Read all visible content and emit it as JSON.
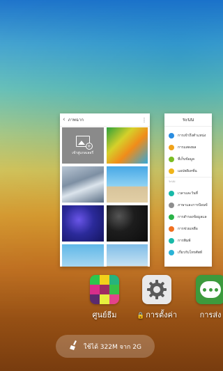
{
  "recent_apps": {
    "gallery_card": {
      "title": "ภาพฉาก",
      "open_gallery_label": "เข้าสู่แกลเลอรี่"
    },
    "settings_card": {
      "title": "ระบบ",
      "items": [
        {
          "label": "การเข้าถึงตำแหน่ง",
          "color": "#2a8de0"
        },
        {
          "label": "การแสดงผล",
          "color": "#f0a21a"
        },
        {
          "label": "ที่เก็บข้อมูล",
          "color": "#7bbd24"
        },
        {
          "label": "แอปพลิเคชั่น",
          "color": "#f0b51a"
        }
      ],
      "section_label": "ระบบ",
      "items2": [
        {
          "label": "เวลาและวันที่",
          "color": "#19b9a8"
        },
        {
          "label": "ภาษาและการป้อนข้",
          "color": "#8e8e8e"
        },
        {
          "label": "การสำรองข้อมูลแล",
          "color": "#2bb348"
        },
        {
          "label": "การช่วยเหลือ",
          "color": "#f07020"
        },
        {
          "label": "การพิมพ์",
          "color": "#19b9a8"
        },
        {
          "label": "เกี่ยวกับโทรศัพท์",
          "color": "#2bb3d6"
        }
      ]
    }
  },
  "dock_apps": [
    {
      "label": "ศูนย์ธีม"
    },
    {
      "label": "การตั้งค่า"
    },
    {
      "label": "การส่ง"
    }
  ],
  "memory": {
    "text": "ใช้ได้ 322M จาก 2G"
  }
}
